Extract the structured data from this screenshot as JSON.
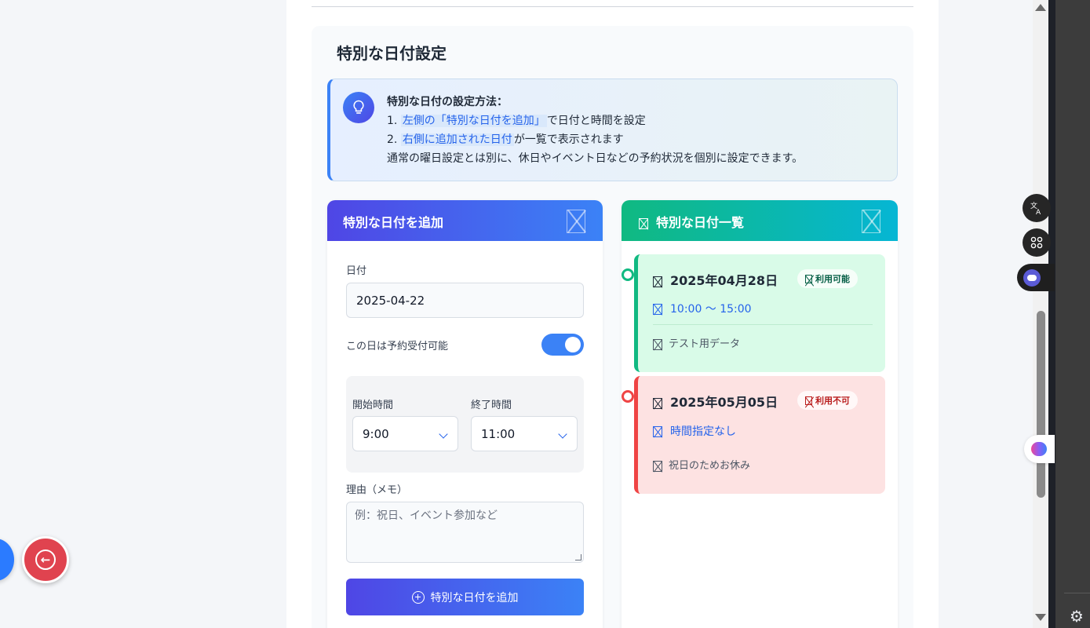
{
  "section": {
    "title": "特別な日付設定"
  },
  "info": {
    "heading": "特別な日付の設定方法：",
    "step1_num": "1.",
    "step1_highlight": "左側の「特別な日付を追加」",
    "step1_rest": "で日付と時間を設定",
    "step2_num": "2.",
    "step2_highlight": "右側に追加された日付",
    "step2_rest": "が一覧で表示されます",
    "note": "通常の曜日設定とは別に、休日やイベント日などの予約状況を個別に設定できます。",
    "icon": "lightbulb-icon"
  },
  "add_panel": {
    "title": "特別な日付を追加",
    "date_label": "日付",
    "date_value": "2025-04-22",
    "available_label": "この日は予約受付可能",
    "available": true,
    "start_label": "開始時間",
    "start_value": "9:00",
    "end_label": "終了時間",
    "end_value": "11:00",
    "memo_label": "理由（メモ）",
    "memo_placeholder": "例：祝日、イベント参加など",
    "submit_label": "特別な日付を追加",
    "accent_color": "#4f46e5"
  },
  "list_panel": {
    "title": "特別な日付一覧",
    "entries": [
      {
        "date": "2025年04月28日",
        "status": "利用可能",
        "time": "10:00 ～ 15:00",
        "note": "テスト用データ",
        "color": "#10b981"
      },
      {
        "date": "2025年05月05日",
        "status": "利用不可",
        "time": "時間指定なし",
        "note": "祝日のためお休み",
        "color": "#ef4444"
      }
    ]
  }
}
